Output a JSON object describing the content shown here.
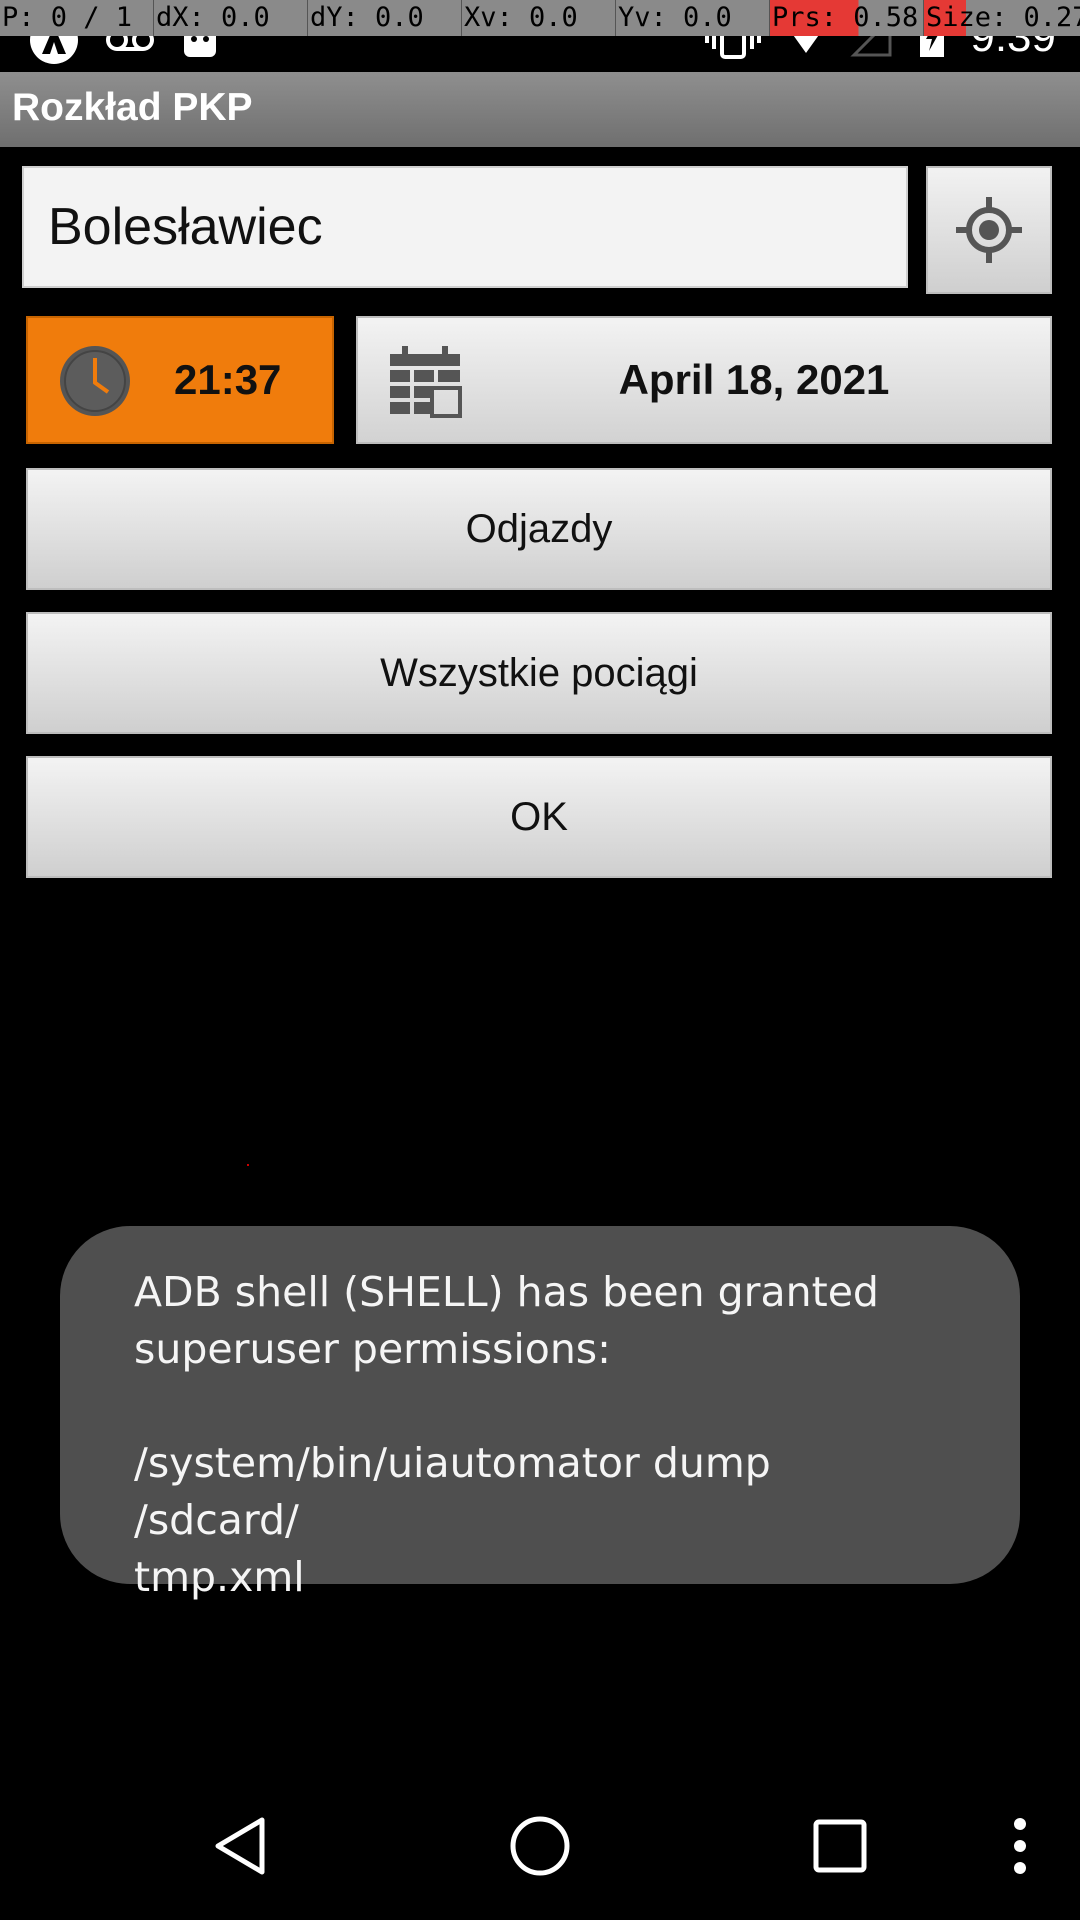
{
  "debug": {
    "pointer": "P: 0 / 1",
    "dx": "dX: 0.0",
    "dy": "dY: 0.0",
    "xv": "Xv: 0.0",
    "yv": "Yv: 0.0",
    "prs": "Prs: 0.58",
    "size": "Size: 0.27"
  },
  "status_bar": {
    "time": "9:39",
    "icons": [
      "app-notification-icon",
      "voicemail-icon",
      "android-icon",
      "vibrate-icon",
      "wifi-icon",
      "signal-icon",
      "battery-icon"
    ]
  },
  "app": {
    "title": "Rozkład PKP"
  },
  "form": {
    "station_value": "Bolesławiec",
    "time_value": "21:37",
    "date_value": "April 18, 2021",
    "departures_label": "Odjazdy",
    "all_trains_label": "Wszystkie pociągi",
    "ok_label": "OK"
  },
  "toast": {
    "message": "ADB shell (SHELL) has been granted\nsuperuser permissions:\n\n/system/bin/uiautomator dump /sdcard/\ntmp.xml"
  },
  "colors": {
    "accent_orange": "#f07c0c",
    "action_bar": "#7f7f7f",
    "toast_bg": "#4f4f4f",
    "debug_highlight": "#e53935"
  },
  "nav_bar": {
    "icons": [
      "back-icon",
      "home-icon",
      "recents-icon",
      "overflow-menu-icon"
    ]
  }
}
